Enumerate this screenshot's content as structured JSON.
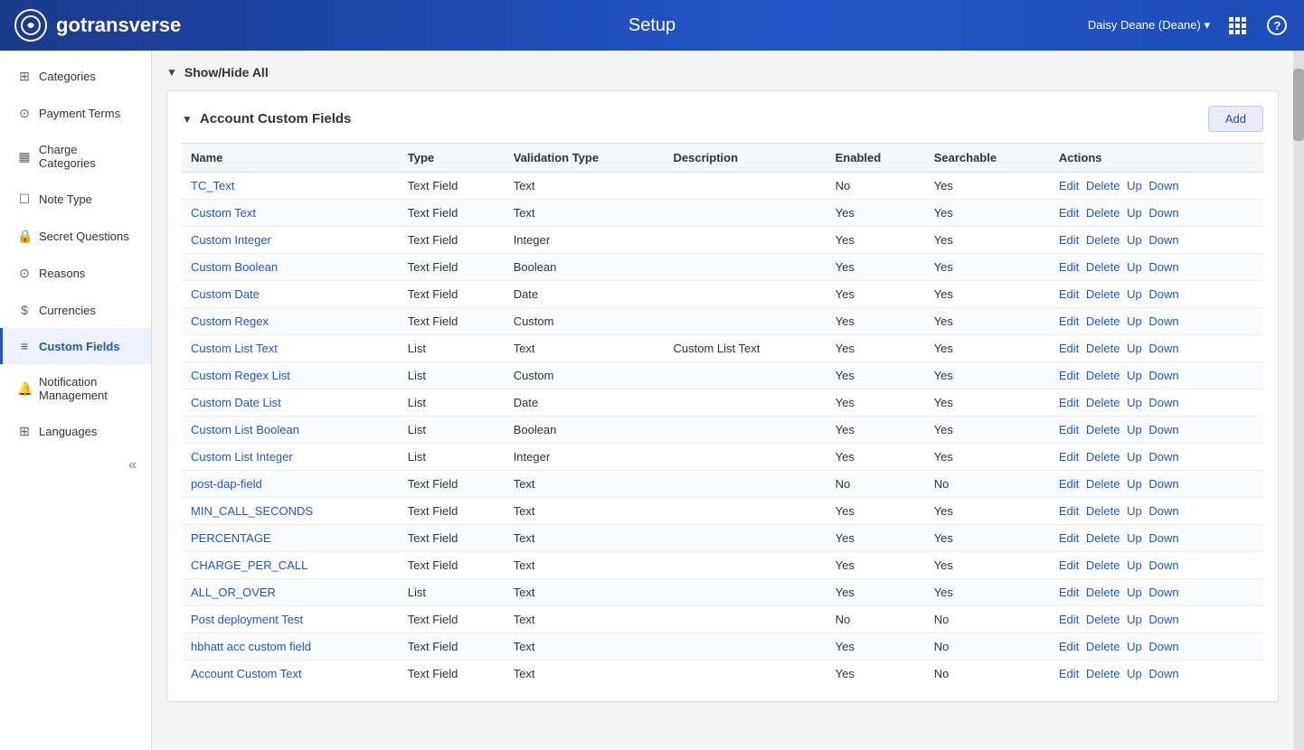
{
  "header": {
    "logo_text": "gotransverse",
    "logo_icon": "L",
    "title": "Setup",
    "user": "Daisy Deane (Deane)",
    "user_dropdown": true
  },
  "sidebar": {
    "items": [
      {
        "id": "categories",
        "label": "Categories",
        "icon": "⊞",
        "active": false
      },
      {
        "id": "payment-terms",
        "label": "Payment Terms",
        "icon": "⊙",
        "active": false
      },
      {
        "id": "charge-categories",
        "label": "Charge Categories",
        "icon": "▦",
        "active": false
      },
      {
        "id": "note-type",
        "label": "Note Type",
        "icon": "☐",
        "active": false
      },
      {
        "id": "secret-questions",
        "label": "Secret Questions",
        "icon": "🔒",
        "active": false
      },
      {
        "id": "reasons",
        "label": "Reasons",
        "icon": "⊙",
        "active": false
      },
      {
        "id": "currencies",
        "label": "Currencies",
        "icon": "$",
        "active": false
      },
      {
        "id": "custom-fields",
        "label": "Custom Fields",
        "icon": "≡",
        "active": true
      },
      {
        "id": "notification-management",
        "label": "Notification Management",
        "icon": "🔔",
        "active": false
      },
      {
        "id": "languages",
        "label": "Languages",
        "icon": "⊞",
        "active": false
      }
    ],
    "collapse_label": "«"
  },
  "content": {
    "show_hide_label": "Show/Hide All",
    "section_title": "Account Custom Fields",
    "add_button_label": "Add",
    "table": {
      "columns": [
        "Name",
        "Type",
        "Validation Type",
        "Description",
        "Enabled",
        "Searchable",
        "Actions"
      ],
      "rows": [
        {
          "name": "TC_Text",
          "type": "Text Field",
          "validation_type": "Text",
          "description": "",
          "enabled": "No",
          "searchable": "Yes"
        },
        {
          "name": "Custom Text",
          "type": "Text Field",
          "validation_type": "Text",
          "description": "",
          "enabled": "Yes",
          "searchable": "Yes"
        },
        {
          "name": "Custom Integer",
          "type": "Text Field",
          "validation_type": "Integer",
          "description": "",
          "enabled": "Yes",
          "searchable": "Yes"
        },
        {
          "name": "Custom Boolean",
          "type": "Text Field",
          "validation_type": "Boolean",
          "description": "",
          "enabled": "Yes",
          "searchable": "Yes"
        },
        {
          "name": "Custom Date",
          "type": "Text Field",
          "validation_type": "Date",
          "description": "",
          "enabled": "Yes",
          "searchable": "Yes"
        },
        {
          "name": "Custom Regex",
          "type": "Text Field",
          "validation_type": "Custom",
          "description": "",
          "enabled": "Yes",
          "searchable": "Yes"
        },
        {
          "name": "Custom List Text",
          "type": "List",
          "validation_type": "Text",
          "description": "Custom List Text",
          "enabled": "Yes",
          "searchable": "Yes"
        },
        {
          "name": "Custom Regex List",
          "type": "List",
          "validation_type": "Custom",
          "description": "",
          "enabled": "Yes",
          "searchable": "Yes"
        },
        {
          "name": "Custom Date List",
          "type": "List",
          "validation_type": "Date",
          "description": "",
          "enabled": "Yes",
          "searchable": "Yes"
        },
        {
          "name": "Custom List Boolean",
          "type": "List",
          "validation_type": "Boolean",
          "description": "",
          "enabled": "Yes",
          "searchable": "Yes"
        },
        {
          "name": "Custom List Integer",
          "type": "List",
          "validation_type": "Integer",
          "description": "",
          "enabled": "Yes",
          "searchable": "Yes"
        },
        {
          "name": "post-dap-field",
          "type": "Text Field",
          "validation_type": "Text",
          "description": "",
          "enabled": "No",
          "searchable": "No"
        },
        {
          "name": "MIN_CALL_SECONDS",
          "type": "Text Field",
          "validation_type": "Text",
          "description": "",
          "enabled": "Yes",
          "searchable": "Yes"
        },
        {
          "name": "PERCENTAGE",
          "type": "Text Field",
          "validation_type": "Text",
          "description": "",
          "enabled": "Yes",
          "searchable": "Yes"
        },
        {
          "name": "CHARGE_PER_CALL",
          "type": "Text Field",
          "validation_type": "Text",
          "description": "",
          "enabled": "Yes",
          "searchable": "Yes"
        },
        {
          "name": "ALL_OR_OVER",
          "type": "List",
          "validation_type": "Text",
          "description": "",
          "enabled": "Yes",
          "searchable": "Yes"
        },
        {
          "name": "Post deployment Test",
          "type": "Text Field",
          "validation_type": "Text",
          "description": "",
          "enabled": "No",
          "searchable": "No"
        },
        {
          "name": "hbhatt acc custom field",
          "type": "Text Field",
          "validation_type": "Text",
          "description": "",
          "enabled": "Yes",
          "searchable": "No"
        },
        {
          "name": "Account Custom Text",
          "type": "Text Field",
          "validation_type": "Text",
          "description": "",
          "enabled": "Yes",
          "searchable": "No"
        }
      ],
      "actions": [
        "Edit",
        "Delete",
        "Up",
        "Down"
      ]
    }
  },
  "colors": {
    "header_bg": "#1a3a8c",
    "sidebar_active_border": "#2355c8",
    "link_color": "#2355c8",
    "add_btn_bg": "#e8eaf6"
  }
}
